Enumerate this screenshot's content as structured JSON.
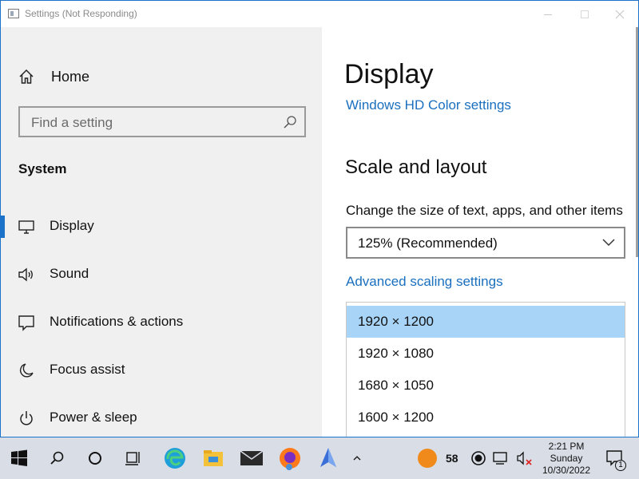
{
  "window": {
    "title": "Settings (Not Responding)"
  },
  "sidebar": {
    "home_label": "Home",
    "search_placeholder": "Find a setting",
    "section_title": "System",
    "items": [
      {
        "label": "Display",
        "icon": "monitor-icon",
        "active": true
      },
      {
        "label": "Sound",
        "icon": "speaker-icon",
        "active": false
      },
      {
        "label": "Notifications & actions",
        "icon": "notification-icon",
        "active": false
      },
      {
        "label": "Focus assist",
        "icon": "moon-icon",
        "active": false
      },
      {
        "label": "Power & sleep",
        "icon": "power-icon",
        "active": false
      }
    ]
  },
  "main": {
    "title": "Display",
    "hd_color_link": "Windows HD Color settings",
    "scale_section_title": "Scale and layout",
    "scale_description": "Change the size of text, apps, and other items",
    "scale_value": "125% (Recommended)",
    "advanced_scaling_link": "Advanced scaling settings",
    "resolution_options": [
      {
        "label": "1920 × 1200",
        "selected": true
      },
      {
        "label": "1920 × 1080",
        "selected": false
      },
      {
        "label": "1680 × 1050",
        "selected": false
      },
      {
        "label": "1600 × 1200",
        "selected": false
      }
    ]
  },
  "taskbar": {
    "apps": [
      "start-icon",
      "search-icon",
      "cortana-icon",
      "task-view-icon",
      "edge-icon",
      "file-explorer-icon",
      "mail-icon",
      "firefox-icon",
      "app-icon",
      "chevron-up-icon"
    ],
    "tray_number": "58",
    "clock": {
      "time": "2:21 PM",
      "day": "Sunday",
      "date": "10/30/2022"
    },
    "notification_count": "1"
  },
  "colors": {
    "accent": "#1a73c9",
    "selected_option": "#a8d4f8",
    "link": "#1a6fbf",
    "sidebar_bg": "#f0f0f0",
    "taskbar_bg": "#d9dde6"
  }
}
